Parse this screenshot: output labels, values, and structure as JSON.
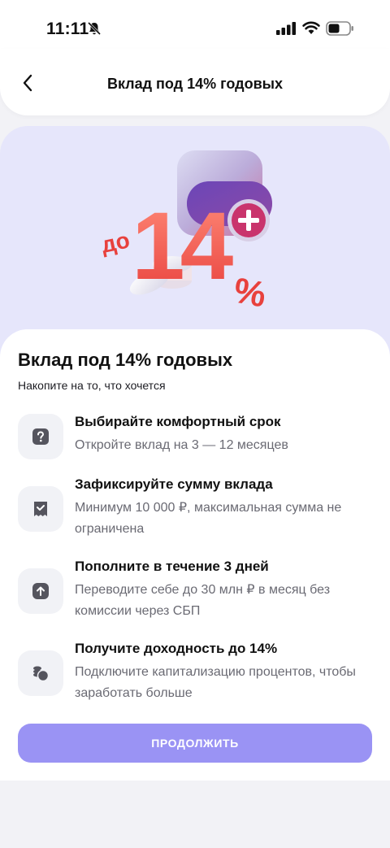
{
  "status_bar": {
    "time": "11:11"
  },
  "header": {
    "title": "Вклад под 14% годовых"
  },
  "hero": {
    "prefix": "до",
    "number": "14",
    "percent": "%"
  },
  "content": {
    "title": "Вклад под 14% годовых",
    "subtitle": "Накопите на то, что хочется"
  },
  "features": [
    {
      "icon": "question-icon",
      "title": "Выбирайте комфортный срок",
      "text": "Откройте вклад на 3 — 12 месяцев"
    },
    {
      "icon": "receipt-icon",
      "title": "Зафиксируйте сумму вклада",
      "text": "Минимум 10 000 ₽, максимальная сумма не ограничена"
    },
    {
      "icon": "arrow-up-icon",
      "title": "Пополните в течение 3 дней",
      "text": "Переводите себе до 30 млн ₽ в месяц без комиссии через СБП"
    },
    {
      "icon": "coins-icon",
      "title": "Получите доходность до 14%",
      "text": "Подключите капитализацию процентов, чтобы заработать больше"
    }
  ],
  "continue_button": {
    "label": "ПРОДОЛЖИТЬ"
  },
  "colors": {
    "accent": "#9a93f4",
    "hero_bg": "#e6e6fb",
    "hero_red": "#f0524a"
  }
}
